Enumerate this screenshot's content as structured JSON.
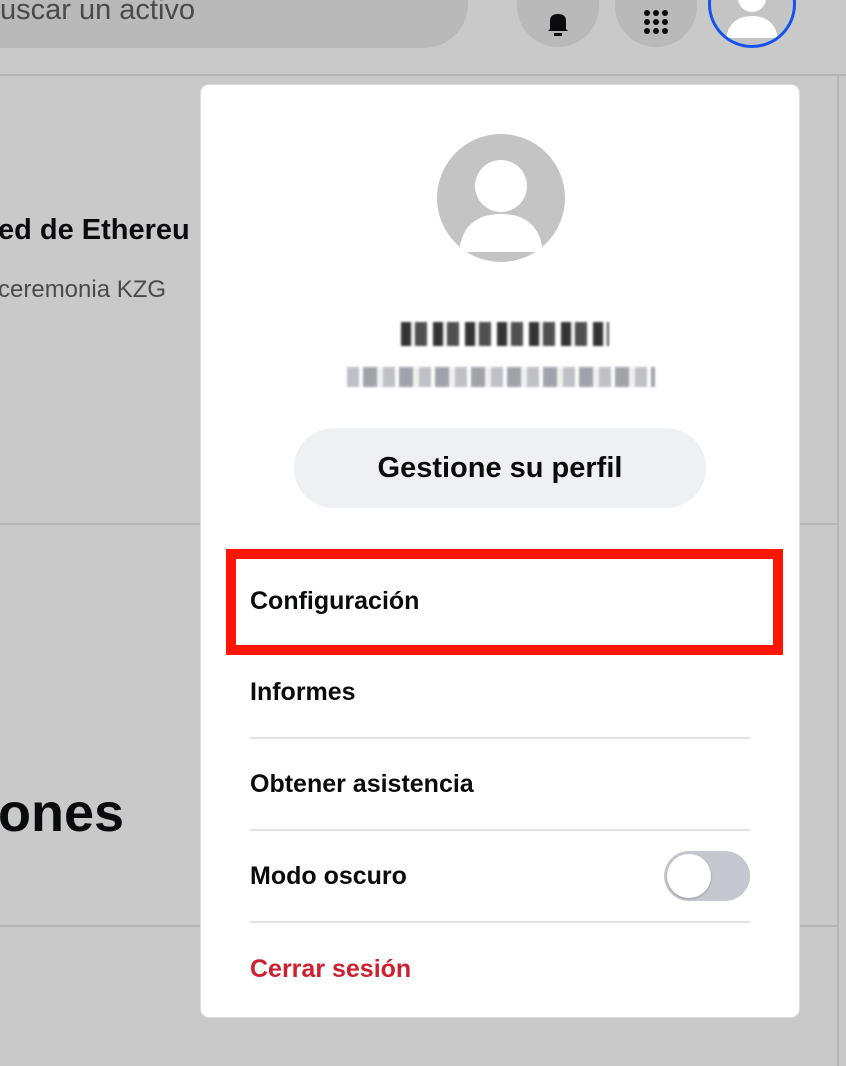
{
  "header": {
    "search_placeholder": "uscar un activo",
    "bell_icon": "bell-icon",
    "apps_icon": "grid-icon",
    "avatar_icon": "user-icon"
  },
  "background": {
    "card_title": "ed de Ethereu",
    "card_subtitle": "ceremonia KZG",
    "section_heading": "ones"
  },
  "profile": {
    "manage_label": "Gestione su perfil"
  },
  "menu": {
    "items": [
      {
        "label": "Configuración"
      },
      {
        "label": "Informes"
      },
      {
        "label": "Obtener asistencia"
      },
      {
        "label": "Modo oscuro",
        "toggle": false
      },
      {
        "label": "Cerrar sesión"
      }
    ]
  },
  "colors": {
    "accent_blue": "#1652f0",
    "logout_red": "#cf202f",
    "highlight_red": "#ff1500"
  }
}
